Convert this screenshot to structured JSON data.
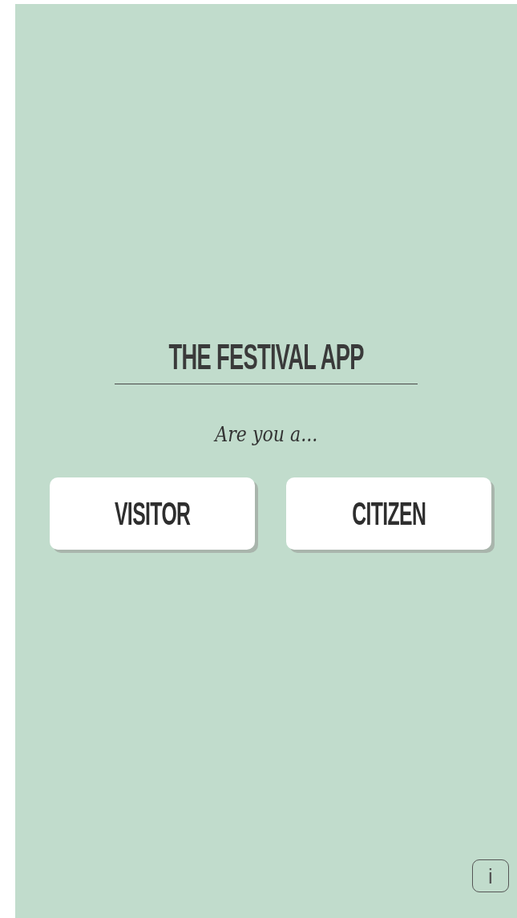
{
  "title": "THE FESTIVAL APP",
  "prompt": "Are you a...",
  "choices": [
    {
      "label": "VISITOR"
    },
    {
      "label": "CITIZEN"
    }
  ],
  "info_button": "i"
}
